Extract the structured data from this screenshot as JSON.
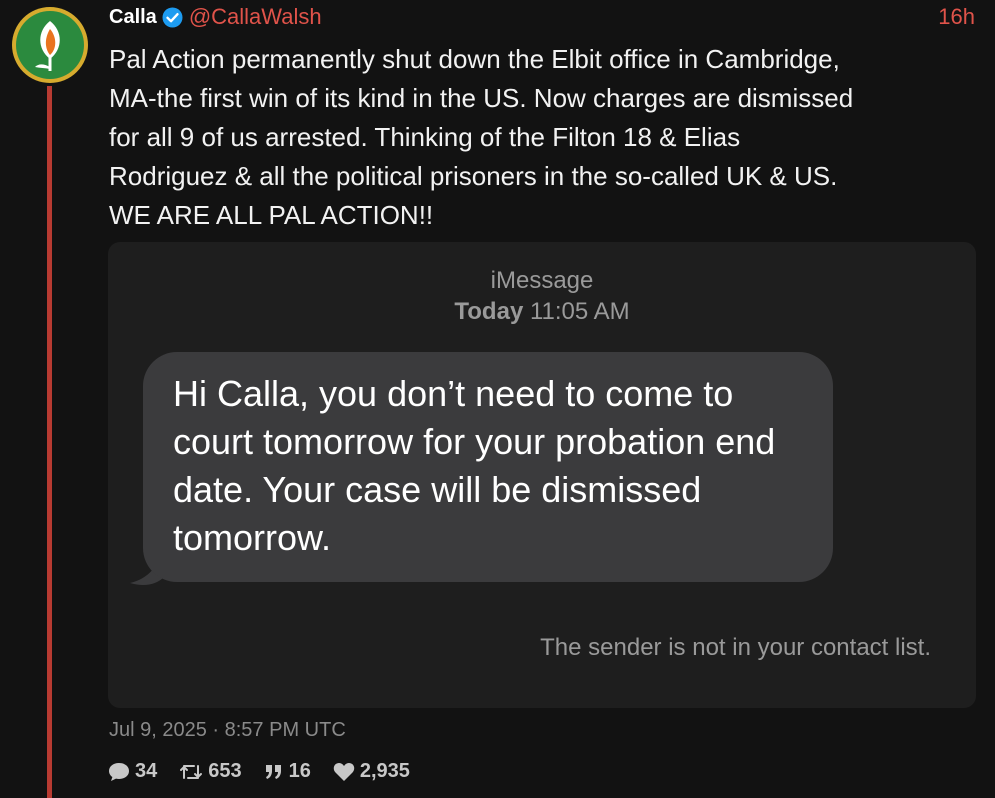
{
  "tweet": {
    "author": {
      "display_name": "Calla",
      "handle": "@CallaWalsh",
      "verified": true
    },
    "relative_time": "16h",
    "text": "Pal Action permanently shut down the Elbit office in Cambridge,\nMA-the first win of its kind in the US. Now charges are dismissed\nfor all 9 of us arrested. Thinking of the Filton 18 & Elias\nRodriguez & all the political prisoners in the so-called UK & US.\nWE ARE ALL PAL ACTION!!",
    "timestamp": "Jul 9, 2025 · 8:57 PM UTC",
    "stats": {
      "replies": "34",
      "retweets": "653",
      "quotes": "16",
      "likes": "2,935"
    }
  },
  "media": {
    "service": "iMessage",
    "day": "Today",
    "time": "11:05 AM",
    "message": "Hi Calla, you don’t need to come to court tomorrow for your probation end date. Your case will be dismissed tomorrow.",
    "sender_note": "The sender is not in your contact list."
  },
  "colors": {
    "background": "#121212",
    "accent": "#e0534a",
    "thread_line": "#b83b32",
    "verified_badge": "#1d9bf0",
    "bubble": "#3b3b3d"
  }
}
